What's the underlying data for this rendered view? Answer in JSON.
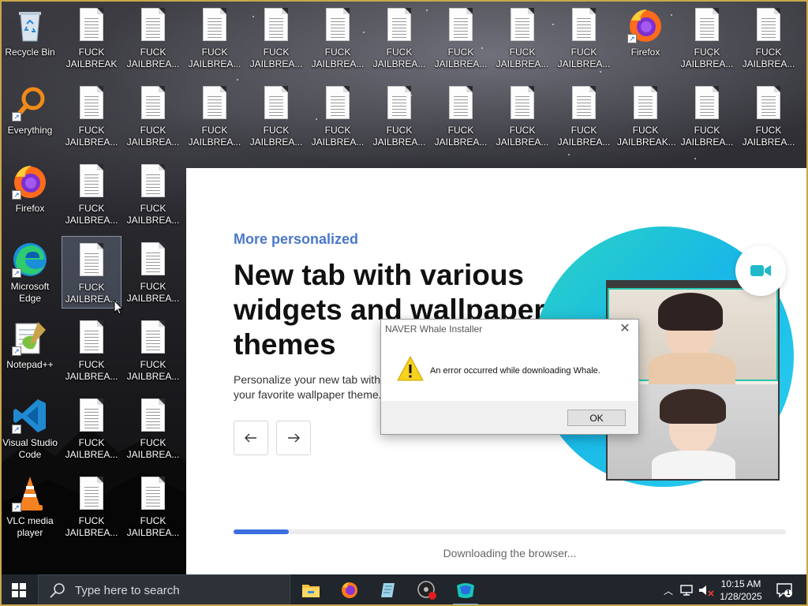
{
  "desktop": {
    "icons": [
      {
        "id": "recycle",
        "label": "Recycle Bin",
        "type": "recycle-bin",
        "col": 0,
        "row": 0,
        "shortcut": false
      },
      {
        "id": "everything",
        "label": "Everything",
        "type": "everything",
        "col": 0,
        "row": 1,
        "shortcut": true
      },
      {
        "id": "firefox1",
        "label": "Firefox",
        "type": "firefox",
        "col": 0,
        "row": 2,
        "shortcut": true
      },
      {
        "id": "edge",
        "label": "Microsoft\nEdge",
        "type": "edge",
        "col": 0,
        "row": 3,
        "shortcut": true
      },
      {
        "id": "notepadpp",
        "label": "Notepad++",
        "type": "notepadpp",
        "col": 0,
        "row": 4,
        "shortcut": true
      },
      {
        "id": "vscode",
        "label": "Visual Studio\nCode",
        "type": "vscode",
        "col": 0,
        "row": 5,
        "shortcut": true
      },
      {
        "id": "vlc",
        "label": "VLC media\nplayer",
        "type": "vlc",
        "col": 0,
        "row": 6,
        "shortcut": true
      },
      {
        "id": "f-1-0",
        "label": "FUCK\nJAILBREAK",
        "type": "doc",
        "col": 1,
        "row": 0
      },
      {
        "id": "f-2-0",
        "label": "FUCK\nJAILBREA...",
        "type": "doc",
        "col": 2,
        "row": 0
      },
      {
        "id": "f-3-0",
        "label": "FUCK\nJAILBREA...",
        "type": "doc",
        "col": 3,
        "row": 0
      },
      {
        "id": "f-4-0",
        "label": "FUCK\nJAILBREA...",
        "type": "doc",
        "col": 4,
        "row": 0
      },
      {
        "id": "f-5-0",
        "label": "FUCK\nJAILBREA...",
        "type": "doc",
        "col": 5,
        "row": 0
      },
      {
        "id": "f-6-0",
        "label": "FUCK\nJAILBREA...",
        "type": "doc",
        "col": 6,
        "row": 0
      },
      {
        "id": "f-7-0",
        "label": "FUCK\nJAILBREA...",
        "type": "doc",
        "col": 7,
        "row": 0
      },
      {
        "id": "f-8-0",
        "label": "FUCK\nJAILBREA...",
        "type": "doc",
        "col": 8,
        "row": 0
      },
      {
        "id": "f-9-0",
        "label": "FUCK\nJAILBREA...",
        "type": "doc",
        "col": 9,
        "row": 0
      },
      {
        "id": "firefox2",
        "label": "Firefox",
        "type": "firefox",
        "col": 10,
        "row": 0,
        "shortcut": true
      },
      {
        "id": "f-11-0",
        "label": "FUCK\nJAILBREA...",
        "type": "doc",
        "col": 11,
        "row": 0
      },
      {
        "id": "f-12-0",
        "label": "FUCK\nJAILBREA...",
        "type": "doc",
        "col": 12,
        "row": 0
      },
      {
        "id": "f-1-1",
        "label": "FUCK\nJAILBREA...",
        "type": "doc",
        "col": 1,
        "row": 1
      },
      {
        "id": "f-2-1",
        "label": "FUCK\nJAILBREA...",
        "type": "doc",
        "col": 2,
        "row": 1
      },
      {
        "id": "f-3-1",
        "label": "FUCK\nJAILBREA...",
        "type": "doc",
        "col": 3,
        "row": 1
      },
      {
        "id": "f-4-1",
        "label": "FUCK\nJAILBREA...",
        "type": "doc",
        "col": 4,
        "row": 1
      },
      {
        "id": "f-5-1",
        "label": "FUCK\nJAILBREA...",
        "type": "doc",
        "col": 5,
        "row": 1
      },
      {
        "id": "f-6-1",
        "label": "FUCK\nJAILBREA...",
        "type": "doc",
        "col": 6,
        "row": 1
      },
      {
        "id": "f-7-1",
        "label": "FUCK\nJAILBREA...",
        "type": "doc",
        "col": 7,
        "row": 1
      },
      {
        "id": "f-8-1",
        "label": "FUCK\nJAILBREA...",
        "type": "doc",
        "col": 8,
        "row": 1
      },
      {
        "id": "f-9-1",
        "label": "FUCK\nJAILBREA...",
        "type": "doc",
        "col": 9,
        "row": 1
      },
      {
        "id": "f-10-1",
        "label": "FUCK\nJAILBREAK...",
        "type": "doc",
        "col": 10,
        "row": 1
      },
      {
        "id": "f-11-1",
        "label": "FUCK\nJAILBREA...",
        "type": "doc",
        "col": 11,
        "row": 1
      },
      {
        "id": "f-12-1",
        "label": "FUCK\nJAILBREA...",
        "type": "doc",
        "col": 12,
        "row": 1
      },
      {
        "id": "f-1-2",
        "label": "FUCK\nJAILBREA...",
        "type": "doc",
        "col": 1,
        "row": 2
      },
      {
        "id": "f-2-2",
        "label": "FUCK\nJAILBREA...",
        "type": "doc",
        "col": 2,
        "row": 2
      },
      {
        "id": "f-1-3",
        "label": "FUCK\nJAILBREA...",
        "type": "doc",
        "col": 1,
        "row": 3,
        "selected": true
      },
      {
        "id": "f-2-3",
        "label": "FUCK\nJAILBREA...",
        "type": "doc",
        "col": 2,
        "row": 3
      },
      {
        "id": "f-1-4",
        "label": "FUCK\nJAILBREA...",
        "type": "doc",
        "col": 1,
        "row": 4
      },
      {
        "id": "f-2-4",
        "label": "FUCK\nJAILBREA...",
        "type": "doc",
        "col": 2,
        "row": 4
      },
      {
        "id": "f-1-5",
        "label": "FUCK\nJAILBREA...",
        "type": "doc",
        "col": 1,
        "row": 5
      },
      {
        "id": "f-2-5",
        "label": "FUCK\nJAILBREA...",
        "type": "doc",
        "col": 2,
        "row": 5
      },
      {
        "id": "f-1-6",
        "label": "FUCK\nJAILBREA...",
        "type": "doc",
        "col": 1,
        "row": 6
      },
      {
        "id": "f-2-6",
        "label": "FUCK\nJAILBREA...",
        "type": "doc",
        "col": 2,
        "row": 6
      }
    ]
  },
  "installer": {
    "kicker": "More personalized",
    "headline": "New tab with various widgets and wallpaper themes",
    "description": "Personalize your new tab with useful widgets and your favorite wallpaper theme.",
    "prev_icon": "arrow-left-icon",
    "next_icon": "arrow-right-icon",
    "progress_fraction": 0.1,
    "status": "Downloading the browser..."
  },
  "dialog": {
    "title": "NAVER Whale Installer",
    "message": "An error occurred while downloading Whale.",
    "ok_label": "OK",
    "icon": "warning-icon"
  },
  "taskbar": {
    "search_placeholder": "Type here to search",
    "apps": [
      "file-explorer",
      "firefox",
      "notepad-app",
      "media-app",
      "whale-installer"
    ],
    "time": "10:15 AM",
    "date": "1/28/2025",
    "notification_count": "1"
  },
  "colors": {
    "accent_blue": "#3b6fe0",
    "kicker_blue": "#4a78c9",
    "taskbar": "#20262c"
  }
}
